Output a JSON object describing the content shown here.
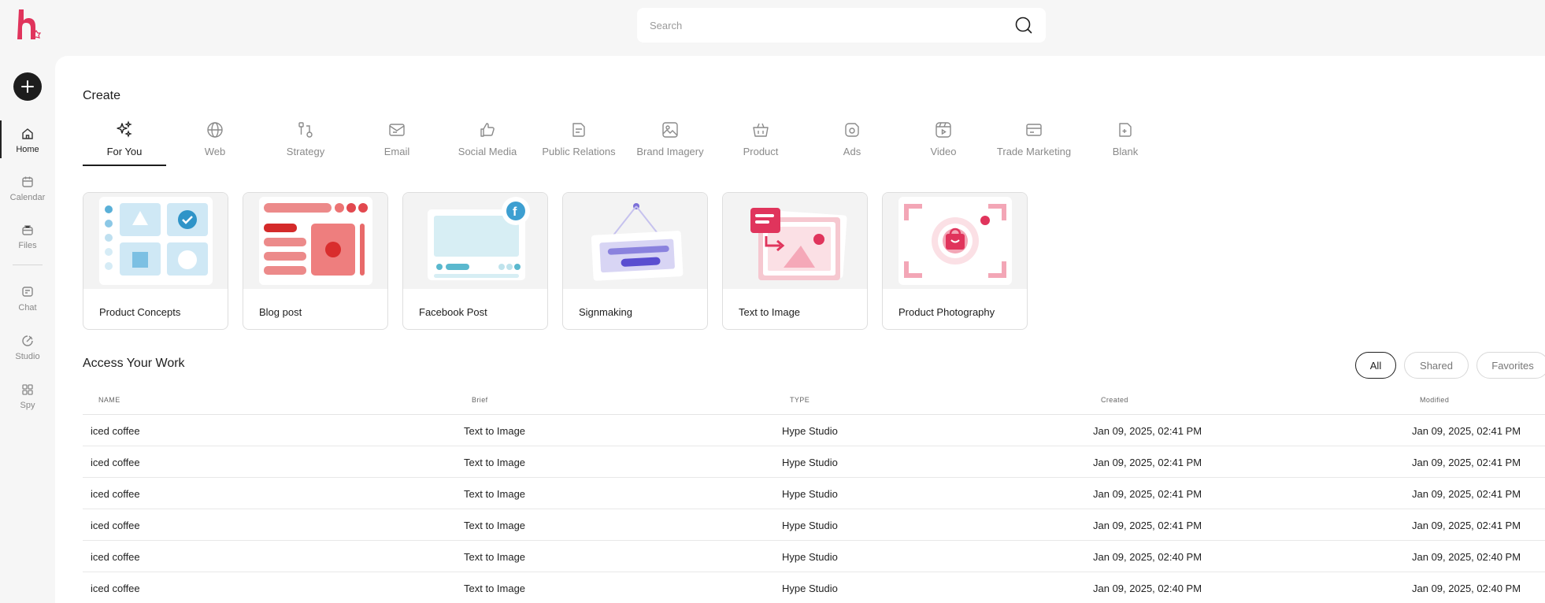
{
  "search": {
    "placeholder": "Search"
  },
  "sidebar": {
    "items": [
      {
        "label": "Home",
        "icon": "home-icon"
      },
      {
        "label": "Calendar",
        "icon": "calendar-icon"
      },
      {
        "label": "Files",
        "icon": "files-icon"
      },
      {
        "label": "Chat",
        "icon": "chat-icon"
      },
      {
        "label": "Studio",
        "icon": "studio-icon"
      },
      {
        "label": "Spy",
        "icon": "spy-icon"
      }
    ]
  },
  "create": {
    "title": "Create",
    "tabs": [
      {
        "label": "For You",
        "icon": "sparkles-icon"
      },
      {
        "label": "Web",
        "icon": "globe-icon"
      },
      {
        "label": "Strategy",
        "icon": "strategy-icon"
      },
      {
        "label": "Email",
        "icon": "email-icon"
      },
      {
        "label": "Social Media",
        "icon": "thumbs-up-icon"
      },
      {
        "label": "Public Relations",
        "icon": "document-icon"
      },
      {
        "label": "Brand Imagery",
        "icon": "image-icon"
      },
      {
        "label": "Product",
        "icon": "basket-icon"
      },
      {
        "label": "Ads",
        "icon": "ads-icon"
      },
      {
        "label": "Video",
        "icon": "video-icon"
      },
      {
        "label": "Trade Marketing",
        "icon": "card-icon"
      },
      {
        "label": "Blank",
        "icon": "blank-icon"
      }
    ],
    "cards": [
      {
        "label": "Product Concepts"
      },
      {
        "label": "Blog post"
      },
      {
        "label": "Facebook Post"
      },
      {
        "label": "Signmaking"
      },
      {
        "label": "Text to Image"
      },
      {
        "label": "Product Photography"
      }
    ]
  },
  "work": {
    "title": "Access Your Work",
    "filters": [
      "All",
      "Shared",
      "Favorites"
    ],
    "columns": [
      "NAME",
      "Brief",
      "TYPE",
      "Created",
      "Modified"
    ],
    "rows": [
      {
        "name": "iced coffee",
        "brief": "Text to Image",
        "type": "Hype Studio",
        "created": "Jan 09, 2025, 02:41 PM",
        "modified": "Jan 09, 2025, 02:41 PM"
      },
      {
        "name": "iced coffee",
        "brief": "Text to Image",
        "type": "Hype Studio",
        "created": "Jan 09, 2025, 02:41 PM",
        "modified": "Jan 09, 2025, 02:41 PM"
      },
      {
        "name": "iced coffee",
        "brief": "Text to Image",
        "type": "Hype Studio",
        "created": "Jan 09, 2025, 02:41 PM",
        "modified": "Jan 09, 2025, 02:41 PM"
      },
      {
        "name": "iced coffee",
        "brief": "Text to Image",
        "type": "Hype Studio",
        "created": "Jan 09, 2025, 02:41 PM",
        "modified": "Jan 09, 2025, 02:41 PM"
      },
      {
        "name": "iced coffee",
        "brief": "Text to Image",
        "type": "Hype Studio",
        "created": "Jan 09, 2025, 02:40 PM",
        "modified": "Jan 09, 2025, 02:40 PM"
      },
      {
        "name": "iced coffee",
        "brief": "Text to Image",
        "type": "Hype Studio",
        "created": "Jan 09, 2025, 02:40 PM",
        "modified": "Jan 09, 2025, 02:40 PM"
      }
    ]
  },
  "colors": {
    "brand": "#e0345c",
    "dark": "#1d1d1d"
  }
}
